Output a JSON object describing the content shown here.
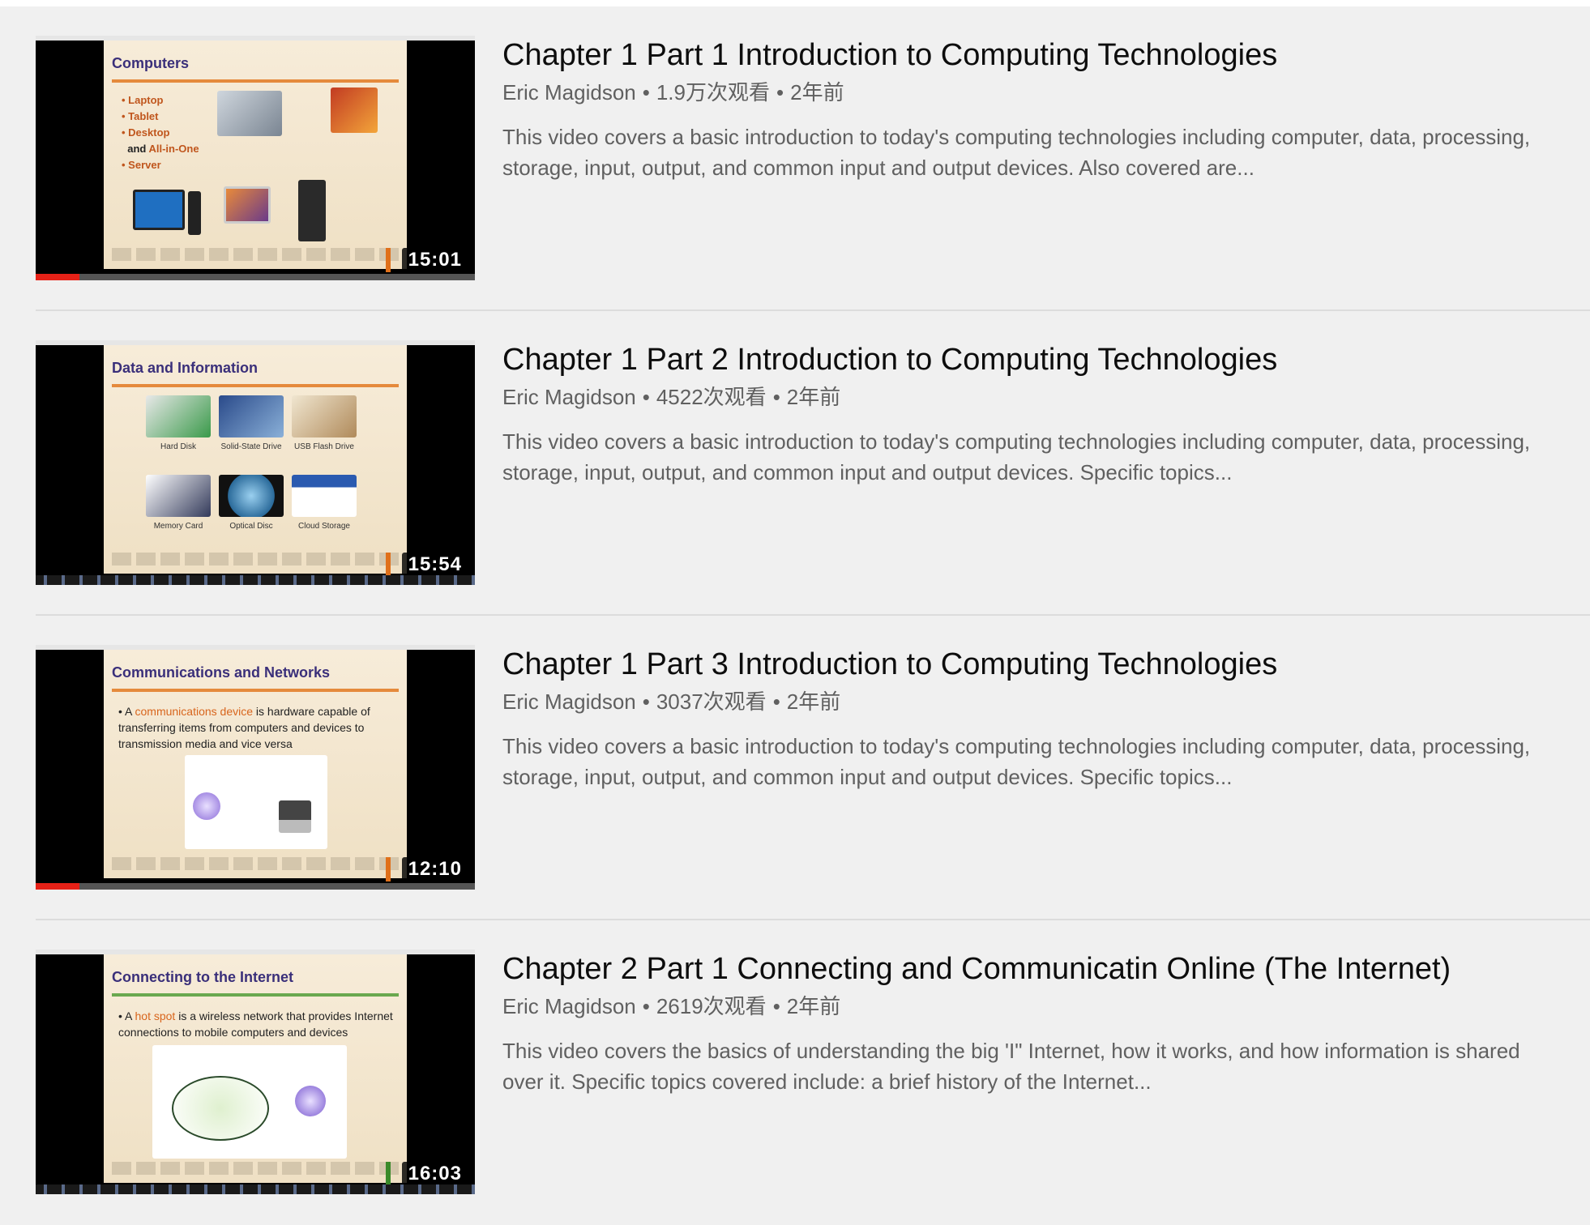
{
  "videos": [
    {
      "title": "Chapter 1 Part 1 Introduction to Computing Technologies",
      "channel": "Eric Magidson",
      "views": "1.9万次观看",
      "age": "2年前",
      "separator": "•",
      "description": "This video covers a basic introduction to today's computing technologies including computer, data, processing, storage, input, output, and common input and output devices. Also covered are...",
      "duration": "15:01",
      "watched_fraction": 0.1,
      "thumbnail": {
        "slide_title": "Computers",
        "bullets": [
          "Laptop",
          "Tablet",
          "Desktop",
          "and ",
          "All-in-One",
          "Server"
        ]
      }
    },
    {
      "title": "Chapter 1 Part 2 Introduction to Computing Technologies",
      "channel": "Eric Magidson",
      "views": "4522次观看",
      "age": "2年前",
      "separator": "•",
      "description": "This video covers a basic introduction to today's computing technologies including computer, data, processing, storage, input, output, and common input and output devices. Specific topics...",
      "duration": "15:54",
      "thumbnail": {
        "slide_title": "Data and Information",
        "captions": [
          "Hard Disk",
          "Solid-State Drive",
          "USB Flash Drive",
          "Memory Card",
          "Optical Disc",
          "Cloud Storage"
        ]
      }
    },
    {
      "title": "Chapter 1 Part 3 Introduction to Computing Technologies",
      "channel": "Eric Magidson",
      "views": "3037次观看",
      "age": "2年前",
      "separator": "•",
      "description": "This video covers a basic introduction to today's computing technologies including computer, data, processing, storage, input, output, and common input and output devices. Specific topics...",
      "duration": "12:10",
      "watched_fraction": 0.1,
      "thumbnail": {
        "slide_title": "Communications and Networks",
        "text_pre": "A ",
        "text_hl": "communications device",
        "text_post": " is hardware capable of transferring items from computers and devices to transmission media and vice versa"
      }
    },
    {
      "title": "Chapter 2 Part 1 Connecting and Communicatin Online (The Internet)",
      "channel": "Eric Magidson",
      "views": "2619次观看",
      "age": "2年前",
      "separator": "•",
      "description": "This video covers the basics of understanding the big 'I\" Internet, how it works, and how information is shared over it. Specific topics covered include: a brief history of the Internet...",
      "duration": "16:03",
      "thumbnail": {
        "slide_title": "Connecting to the Internet",
        "text_pre": "A ",
        "text_hl": "hot spot",
        "text_post": " is a wireless network that provides Internet connections to mobile computers and devices"
      }
    }
  ],
  "colors": {
    "duration_tab_default": "#e0701a",
    "duration_tab_last": "#3a8a2a",
    "progress_fill": "#e62117"
  }
}
